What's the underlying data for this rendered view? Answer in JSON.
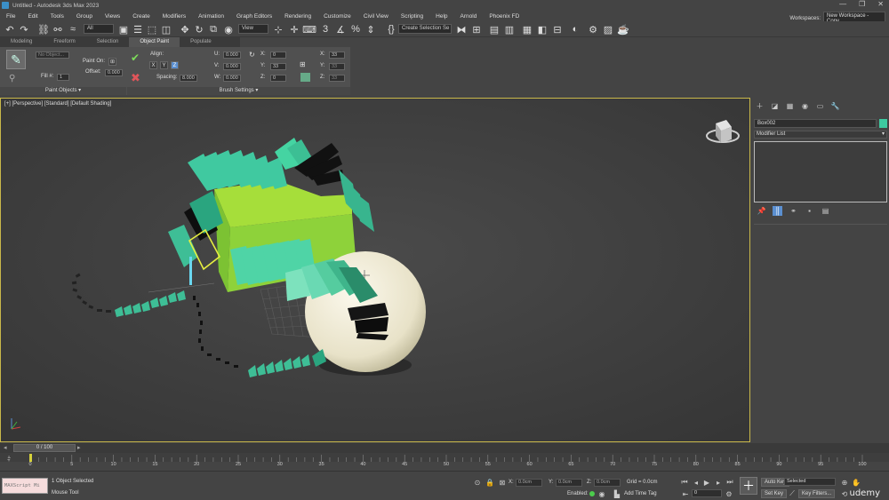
{
  "window": {
    "title": "Untitled - Autodesk 3ds Max 2023",
    "controls": [
      "—",
      "❐",
      "✕"
    ]
  },
  "menu": {
    "items": [
      "File",
      "Edit",
      "Tools",
      "Group",
      "Views",
      "Create",
      "Modifiers",
      "Animation",
      "Graph Editors",
      "Rendering",
      "Customize",
      "Civil View",
      "Scripting",
      "Help",
      "Arnold",
      "Phoenix FD"
    ],
    "workspaces_label": "Workspaces:",
    "workspace_value": "New Workspace - Copy"
  },
  "toolbar": {
    "filter_value": "All",
    "coord_system": "View",
    "selection_set": "Create Selection Se"
  },
  "ribbon": {
    "tabs": [
      "Modeling",
      "Freeform",
      "Selection",
      "Object Paint",
      "Populate"
    ],
    "active_tab": "Object Paint",
    "no_object": "No Object...",
    "fill_label": "Fill #:",
    "fill_value": "1",
    "paint_on_label": "Paint On:",
    "offset_label": "Offset:",
    "offset_value": "0.000",
    "align_label": "Align:",
    "axis_x": "X",
    "axis_y": "Y",
    "axis_z": "Z",
    "spacing_label": "Spacing:",
    "spacing_value": "8.000",
    "u_label": "U:",
    "v_label": "V:",
    "w_label": "W:",
    "u_value": "0.000",
    "v_value": "0.000",
    "w_value": "0.000",
    "rot_x_label": "X:",
    "rot_y_label": "Y:",
    "rot_z_label": "Z:",
    "rot_x_value": "0",
    "rot_y_value": "33",
    "rot_z_value": "0",
    "scale_x_label": "X:",
    "scale_y_label": "Y:",
    "scale_z_label": "Z:",
    "scale_x_value": "33",
    "scale_y_value": "33",
    "scale_z_value": "33",
    "paint_objects_label": "Paint Objects ▾",
    "brush_settings_label": "Brush Settings ▾"
  },
  "viewport": {
    "label": "[+] [Perspective] [Standard] [Default Shading]"
  },
  "command_panel": {
    "object_name": "Box002",
    "object_color": "#3ec9a0",
    "modifier_list": "Modifier List"
  },
  "timeline": {
    "frame_display": "0 / 100",
    "ticks": [
      "0",
      "5",
      "10",
      "15",
      "20",
      "25",
      "30",
      "35",
      "40",
      "45",
      "50",
      "55",
      "60",
      "65",
      "70",
      "75",
      "80",
      "85",
      "90",
      "95",
      "100"
    ]
  },
  "status": {
    "maxscript_text": "MAXScript Mi",
    "selection_status": "1 Object Selected",
    "prompt": "Mouse Tool",
    "x_label": "X:",
    "x_value": "0.0cm",
    "y_label": "Y:",
    "y_value": "0.0cm",
    "z_label": "Z:",
    "z_value": "0.0cm",
    "grid": "Grid = 0.0cm",
    "enabled_label": "Enabled:",
    "add_time_tag": "Add Time Tag",
    "auto_key": "Auto Key",
    "set_key": "Set Key",
    "selected_value": "Selected",
    "key_filters": "Key Filters...",
    "frame_value": "0",
    "watermark": "udemy"
  }
}
